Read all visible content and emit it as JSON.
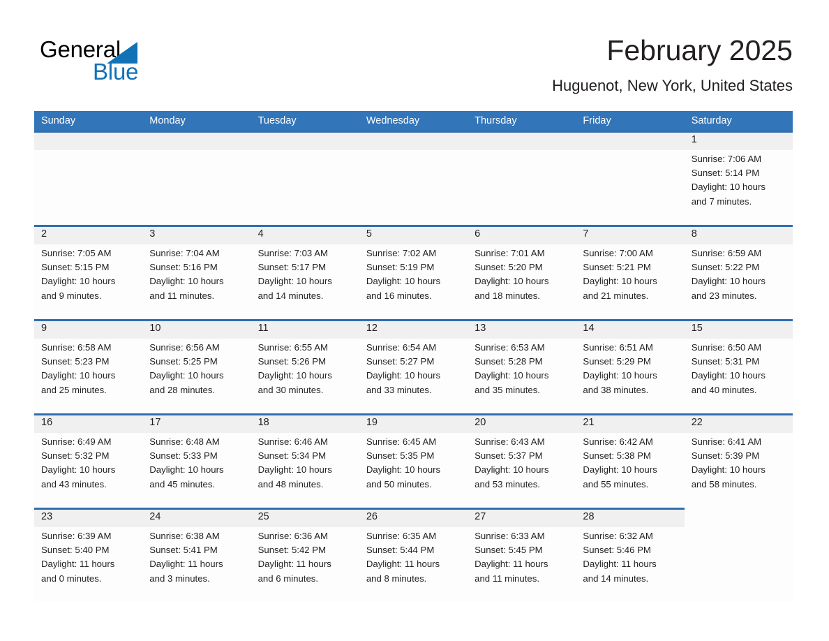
{
  "brand": {
    "name_part1": "General",
    "name_part2": "Blue",
    "triangle_color": "#1272b6",
    "text_color": "#010101"
  },
  "header": {
    "title": "February 2025",
    "subtitle": "Huguenot, New York, United States"
  },
  "colors": {
    "header_blue": "#3275b8",
    "row_rule_blue": "#2f6eb0",
    "daynum_band": "#f0f0f0",
    "text": "#231f20",
    "page_background": "#ffffff"
  },
  "weekdays": [
    "Sunday",
    "Monday",
    "Tuesday",
    "Wednesday",
    "Thursday",
    "Friday",
    "Saturday"
  ],
  "weeks": [
    [
      {
        "day": "",
        "sunrise": "",
        "sunset": "",
        "daylight_line1": "",
        "daylight_line2": "",
        "banded": true
      },
      {
        "day": "",
        "sunrise": "",
        "sunset": "",
        "daylight_line1": "",
        "daylight_line2": "",
        "banded": true
      },
      {
        "day": "",
        "sunrise": "",
        "sunset": "",
        "daylight_line1": "",
        "daylight_line2": "",
        "banded": true
      },
      {
        "day": "",
        "sunrise": "",
        "sunset": "",
        "daylight_line1": "",
        "daylight_line2": "",
        "banded": true
      },
      {
        "day": "",
        "sunrise": "",
        "sunset": "",
        "daylight_line1": "",
        "daylight_line2": "",
        "banded": true
      },
      {
        "day": "",
        "sunrise": "",
        "sunset": "",
        "daylight_line1": "",
        "daylight_line2": "",
        "banded": true
      },
      {
        "day": "1",
        "sunrise": "Sunrise: 7:06 AM",
        "sunset": "Sunset: 5:14 PM",
        "daylight_line1": "Daylight: 10 hours",
        "daylight_line2": "and 7 minutes.",
        "banded": true
      }
    ],
    [
      {
        "day": "2",
        "sunrise": "Sunrise: 7:05 AM",
        "sunset": "Sunset: 5:15 PM",
        "daylight_line1": "Daylight: 10 hours",
        "daylight_line2": "and 9 minutes.",
        "banded": true
      },
      {
        "day": "3",
        "sunrise": "Sunrise: 7:04 AM",
        "sunset": "Sunset: 5:16 PM",
        "daylight_line1": "Daylight: 10 hours",
        "daylight_line2": "and 11 minutes.",
        "banded": true
      },
      {
        "day": "4",
        "sunrise": "Sunrise: 7:03 AM",
        "sunset": "Sunset: 5:17 PM",
        "daylight_line1": "Daylight: 10 hours",
        "daylight_line2": "and 14 minutes.",
        "banded": true
      },
      {
        "day": "5",
        "sunrise": "Sunrise: 7:02 AM",
        "sunset": "Sunset: 5:19 PM",
        "daylight_line1": "Daylight: 10 hours",
        "daylight_line2": "and 16 minutes.",
        "banded": true
      },
      {
        "day": "6",
        "sunrise": "Sunrise: 7:01 AM",
        "sunset": "Sunset: 5:20 PM",
        "daylight_line1": "Daylight: 10 hours",
        "daylight_line2": "and 18 minutes.",
        "banded": true
      },
      {
        "day": "7",
        "sunrise": "Sunrise: 7:00 AM",
        "sunset": "Sunset: 5:21 PM",
        "daylight_line1": "Daylight: 10 hours",
        "daylight_line2": "and 21 minutes.",
        "banded": true
      },
      {
        "day": "8",
        "sunrise": "Sunrise: 6:59 AM",
        "sunset": "Sunset: 5:22 PM",
        "daylight_line1": "Daylight: 10 hours",
        "daylight_line2": "and 23 minutes.",
        "banded": true
      }
    ],
    [
      {
        "day": "9",
        "sunrise": "Sunrise: 6:58 AM",
        "sunset": "Sunset: 5:23 PM",
        "daylight_line1": "Daylight: 10 hours",
        "daylight_line2": "and 25 minutes.",
        "banded": true
      },
      {
        "day": "10",
        "sunrise": "Sunrise: 6:56 AM",
        "sunset": "Sunset: 5:25 PM",
        "daylight_line1": "Daylight: 10 hours",
        "daylight_line2": "and 28 minutes.",
        "banded": true
      },
      {
        "day": "11",
        "sunrise": "Sunrise: 6:55 AM",
        "sunset": "Sunset: 5:26 PM",
        "daylight_line1": "Daylight: 10 hours",
        "daylight_line2": "and 30 minutes.",
        "banded": true
      },
      {
        "day": "12",
        "sunrise": "Sunrise: 6:54 AM",
        "sunset": "Sunset: 5:27 PM",
        "daylight_line1": "Daylight: 10 hours",
        "daylight_line2": "and 33 minutes.",
        "banded": true
      },
      {
        "day": "13",
        "sunrise": "Sunrise: 6:53 AM",
        "sunset": "Sunset: 5:28 PM",
        "daylight_line1": "Daylight: 10 hours",
        "daylight_line2": "and 35 minutes.",
        "banded": true
      },
      {
        "day": "14",
        "sunrise": "Sunrise: 6:51 AM",
        "sunset": "Sunset: 5:29 PM",
        "daylight_line1": "Daylight: 10 hours",
        "daylight_line2": "and 38 minutes.",
        "banded": true
      },
      {
        "day": "15",
        "sunrise": "Sunrise: 6:50 AM",
        "sunset": "Sunset: 5:31 PM",
        "daylight_line1": "Daylight: 10 hours",
        "daylight_line2": "and 40 minutes.",
        "banded": true
      }
    ],
    [
      {
        "day": "16",
        "sunrise": "Sunrise: 6:49 AM",
        "sunset": "Sunset: 5:32 PM",
        "daylight_line1": "Daylight: 10 hours",
        "daylight_line2": "and 43 minutes.",
        "banded": true
      },
      {
        "day": "17",
        "sunrise": "Sunrise: 6:48 AM",
        "sunset": "Sunset: 5:33 PM",
        "daylight_line1": "Daylight: 10 hours",
        "daylight_line2": "and 45 minutes.",
        "banded": true
      },
      {
        "day": "18",
        "sunrise": "Sunrise: 6:46 AM",
        "sunset": "Sunset: 5:34 PM",
        "daylight_line1": "Daylight: 10 hours",
        "daylight_line2": "and 48 minutes.",
        "banded": true
      },
      {
        "day": "19",
        "sunrise": "Sunrise: 6:45 AM",
        "sunset": "Sunset: 5:35 PM",
        "daylight_line1": "Daylight: 10 hours",
        "daylight_line2": "and 50 minutes.",
        "banded": true
      },
      {
        "day": "20",
        "sunrise": "Sunrise: 6:43 AM",
        "sunset": "Sunset: 5:37 PM",
        "daylight_line1": "Daylight: 10 hours",
        "daylight_line2": "and 53 minutes.",
        "banded": true
      },
      {
        "day": "21",
        "sunrise": "Sunrise: 6:42 AM",
        "sunset": "Sunset: 5:38 PM",
        "daylight_line1": "Daylight: 10 hours",
        "daylight_line2": "and 55 minutes.",
        "banded": true
      },
      {
        "day": "22",
        "sunrise": "Sunrise: 6:41 AM",
        "sunset": "Sunset: 5:39 PM",
        "daylight_line1": "Daylight: 10 hours",
        "daylight_line2": "and 58 minutes.",
        "banded": true
      }
    ],
    [
      {
        "day": "23",
        "sunrise": "Sunrise: 6:39 AM",
        "sunset": "Sunset: 5:40 PM",
        "daylight_line1": "Daylight: 11 hours",
        "daylight_line2": "and 0 minutes.",
        "banded": true
      },
      {
        "day": "24",
        "sunrise": "Sunrise: 6:38 AM",
        "sunset": "Sunset: 5:41 PM",
        "daylight_line1": "Daylight: 11 hours",
        "daylight_line2": "and 3 minutes.",
        "banded": true
      },
      {
        "day": "25",
        "sunrise": "Sunrise: 6:36 AM",
        "sunset": "Sunset: 5:42 PM",
        "daylight_line1": "Daylight: 11 hours",
        "daylight_line2": "and 6 minutes.",
        "banded": true
      },
      {
        "day": "26",
        "sunrise": "Sunrise: 6:35 AM",
        "sunset": "Sunset: 5:44 PM",
        "daylight_line1": "Daylight: 11 hours",
        "daylight_line2": "and 8 minutes.",
        "banded": true
      },
      {
        "day": "27",
        "sunrise": "Sunrise: 6:33 AM",
        "sunset": "Sunset: 5:45 PM",
        "daylight_line1": "Daylight: 11 hours",
        "daylight_line2": "and 11 minutes.",
        "banded": true
      },
      {
        "day": "28",
        "sunrise": "Sunrise: 6:32 AM",
        "sunset": "Sunset: 5:46 PM",
        "daylight_line1": "Daylight: 11 hours",
        "daylight_line2": "and 14 minutes.",
        "banded": true
      },
      {
        "day": "",
        "sunrise": "",
        "sunset": "",
        "daylight_line1": "",
        "daylight_line2": "",
        "banded": false
      }
    ]
  ]
}
